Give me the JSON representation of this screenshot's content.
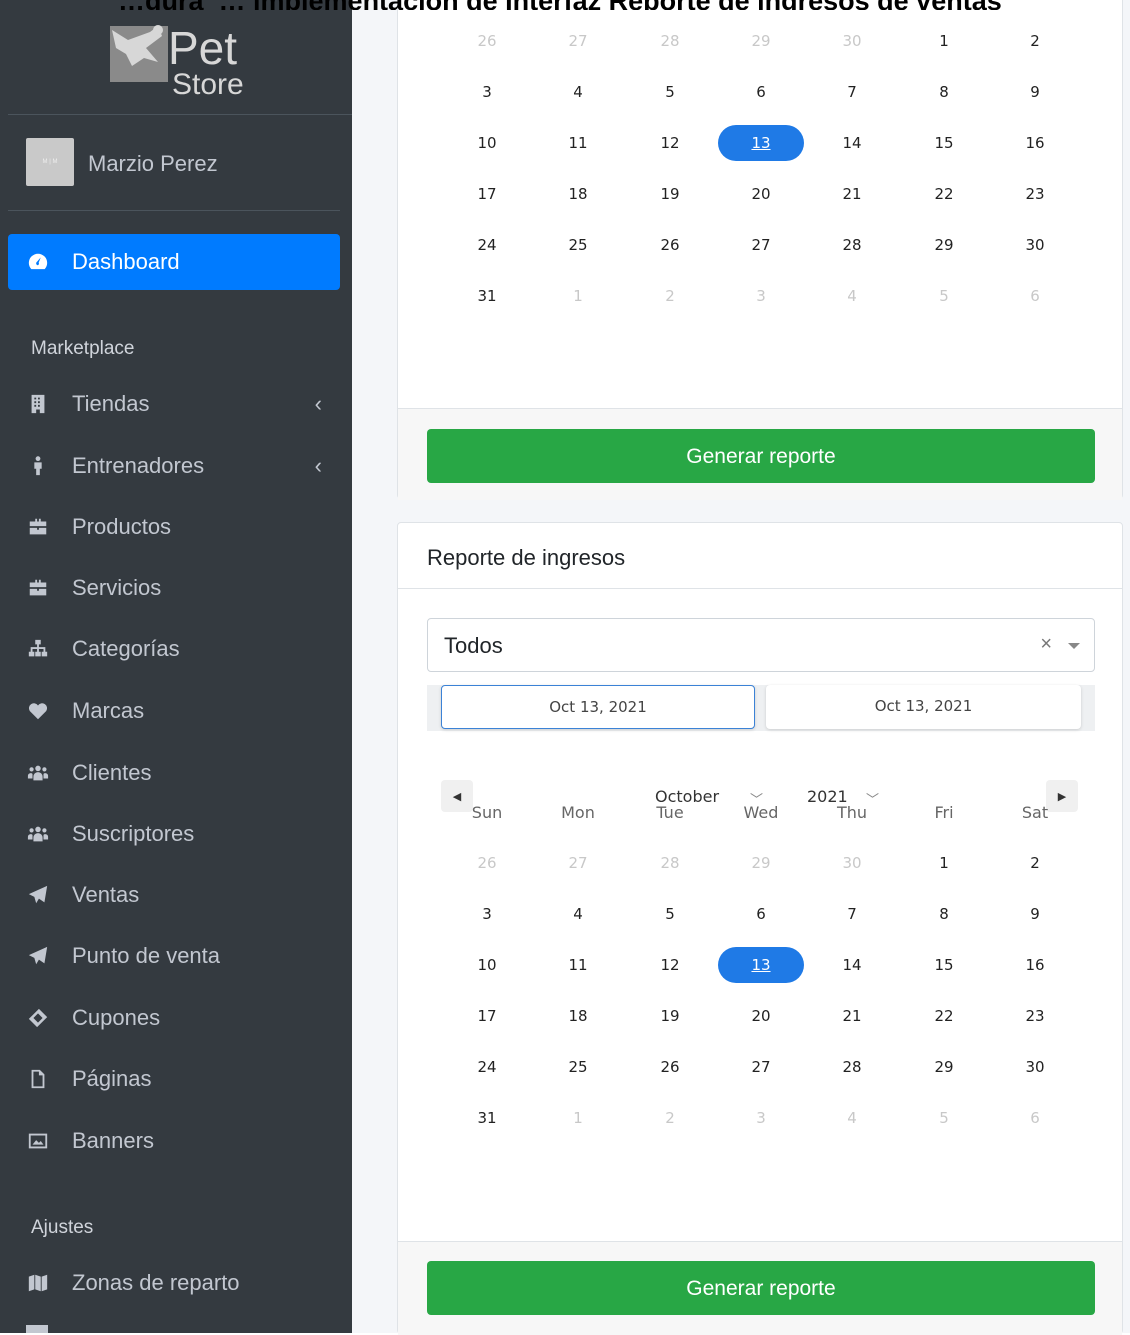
{
  "top_heading": "…gura_… implementación de Interfaz Reporte de ingresos de ventas",
  "brand": {
    "pet": "Pet",
    "store": "Store"
  },
  "user": {
    "name": "Marzio Perez",
    "avatar_text": "M | M"
  },
  "sidebar": {
    "dashboard": "Dashboard",
    "header_marketplace": "Marketplace",
    "items": [
      {
        "label": "Tiendas",
        "icon": "building-icon",
        "caret": "‹"
      },
      {
        "label": "Entrenadores",
        "icon": "person-icon",
        "caret": "‹"
      },
      {
        "label": "Productos",
        "icon": "briefcase-icon"
      },
      {
        "label": "Servicios",
        "icon": "briefcase-icon"
      },
      {
        "label": "Categorías",
        "icon": "sitemap-icon"
      },
      {
        "label": "Marcas",
        "icon": "heart-icon"
      },
      {
        "label": "Clientes",
        "icon": "users-icon"
      },
      {
        "label": "Suscriptores",
        "icon": "users-icon"
      },
      {
        "label": "Ventas",
        "icon": "paper-plane-icon"
      },
      {
        "label": "Punto de venta",
        "icon": "paper-plane-icon"
      },
      {
        "label": "Cupones",
        "icon": "ticket-icon"
      },
      {
        "label": "Páginas",
        "icon": "file-icon"
      },
      {
        "label": "Banners",
        "icon": "image-icon"
      }
    ],
    "header_ajustes": "Ajustes",
    "zonas": {
      "label": "Zonas de reparto",
      "icon": "map-icon"
    }
  },
  "calendar": {
    "dow": [
      "Sun",
      "Mon",
      "Tue",
      "Wed",
      "Thu",
      "Fri",
      "Sat"
    ],
    "weeks": [
      [
        "26",
        "27",
        "28",
        "29",
        "30",
        "1",
        "2"
      ],
      [
        "3",
        "4",
        "5",
        "6",
        "7",
        "8",
        "9"
      ],
      [
        "10",
        "11",
        "12",
        "13",
        "14",
        "15",
        "16"
      ],
      [
        "17",
        "18",
        "19",
        "20",
        "21",
        "22",
        "23"
      ],
      [
        "24",
        "25",
        "26",
        "27",
        "28",
        "29",
        "30"
      ],
      [
        "31",
        "1",
        "2",
        "3",
        "4",
        "5",
        "6"
      ]
    ],
    "selected": "13"
  },
  "card1": {
    "button": "Generar reporte"
  },
  "card2": {
    "title": "Reporte de ingresos",
    "select_value": "Todos",
    "select_clear": "×",
    "date_start": "Oct 13, 2021",
    "date_end": "Oct 13, 2021",
    "month": "October",
    "year": "2021",
    "prev": "◀",
    "next": "▶",
    "button": "Generar reporte"
  },
  "colors": {
    "sidebar": "#343a40",
    "active": "#007bff",
    "green": "#28a745",
    "selected_day": "#1f7ae6"
  }
}
